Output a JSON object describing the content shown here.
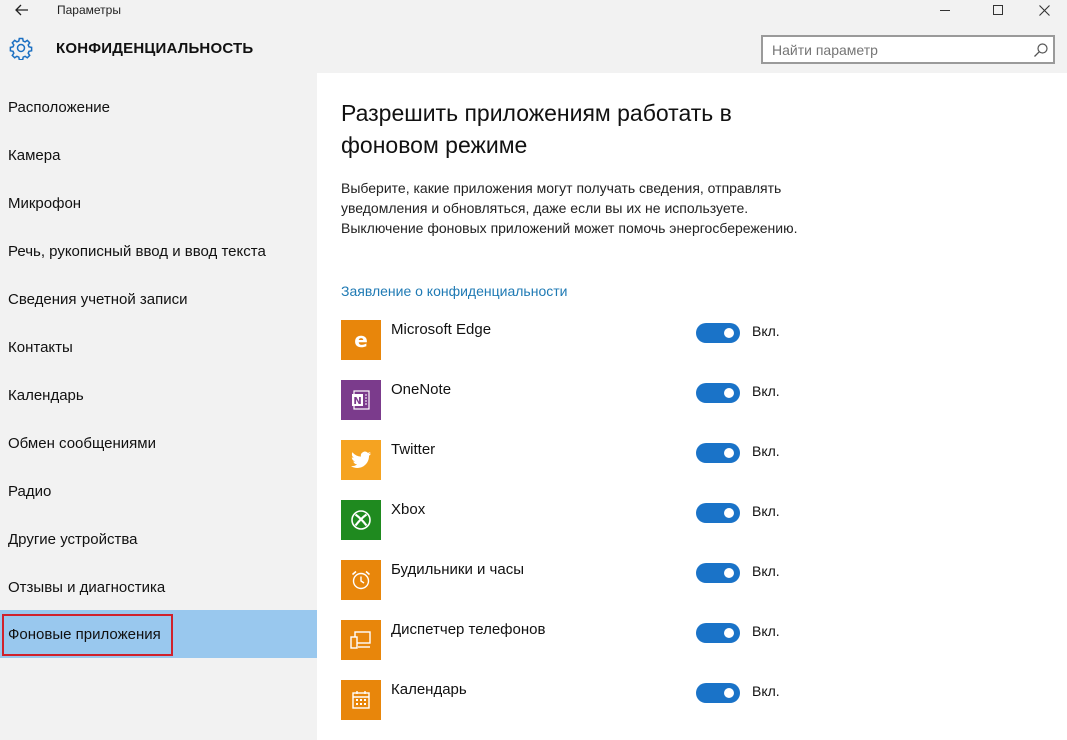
{
  "window": {
    "title": "Параметры",
    "back_icon": "back-arrow-icon"
  },
  "header": {
    "section_title": "КОНФИДЕНЦИАЛЬНОСТЬ",
    "icon": "gear-icon",
    "search_placeholder": "Найти параметр"
  },
  "sidebar": {
    "items": [
      {
        "label": "Расположение"
      },
      {
        "label": "Камера"
      },
      {
        "label": "Микрофон"
      },
      {
        "label": "Речь, рукописный ввод и ввод текста"
      },
      {
        "label": "Сведения учетной записи"
      },
      {
        "label": "Контакты"
      },
      {
        "label": "Календарь"
      },
      {
        "label": "Обмен сообщениями"
      },
      {
        "label": "Радио"
      },
      {
        "label": "Другие устройства"
      },
      {
        "label": "Отзывы и диагностика"
      },
      {
        "label": "Фоновые приложения",
        "selected": true
      }
    ]
  },
  "main": {
    "title": "Разрешить приложениям работать в фоновом режиме",
    "description": "Выберите, какие приложения могут получать сведения, отправлять уведомления и обновляться, даже если вы их не используете. Выключение фоновых приложений может помочь энергосбережению.",
    "privacy_link": "Заявление о конфиденциальности",
    "apps": [
      {
        "name": "Microsoft Edge",
        "state": "Вкл.",
        "on": true,
        "tile_color": "#e8860b",
        "icon": "edge-icon"
      },
      {
        "name": "OneNote",
        "state": "Вкл.",
        "on": true,
        "tile_color": "#7b3b8c",
        "icon": "onenote-icon"
      },
      {
        "name": "Twitter",
        "state": "Вкл.",
        "on": true,
        "tile_color": "#f5a321",
        "icon": "twitter-bird-icon"
      },
      {
        "name": "Xbox",
        "state": "Вкл.",
        "on": true,
        "tile_color": "#1f8a1f",
        "icon": "xbox-icon"
      },
      {
        "name": "Будильники и часы",
        "state": "Вкл.",
        "on": true,
        "tile_color": "#e8860b",
        "icon": "alarm-clock-icon"
      },
      {
        "name": "Диспетчер телефонов",
        "state": "Вкл.",
        "on": true,
        "tile_color": "#e8860b",
        "icon": "phone-companion-icon"
      },
      {
        "name": "Календарь",
        "state": "Вкл.",
        "on": true,
        "tile_color": "#e8860b",
        "icon": "calendar-icon"
      }
    ]
  },
  "colors": {
    "accent": "#1a73c8",
    "selected_item": "#99c8ee",
    "highlight_outline": "#d0212b",
    "link": "#1f7ab4"
  }
}
